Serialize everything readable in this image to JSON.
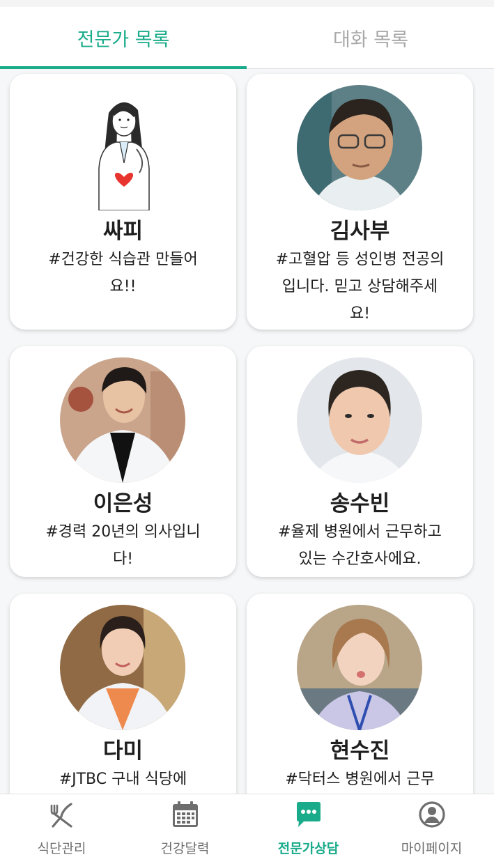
{
  "tabs": [
    {
      "label": "전문가 목록",
      "active": true
    },
    {
      "label": "대화 목록",
      "active": false
    }
  ],
  "colors": {
    "accent": "#1aab8a",
    "inactive_tab": "#a8a8a8",
    "nav_icon": "#6e6e6e"
  },
  "experts": [
    {
      "name": "싸피",
      "description": "#건강한 식습관 만들어요!!",
      "avatar": "illustrated-doctor-holding-heart"
    },
    {
      "name": "김사부",
      "description": "#고혈압 등 성인병 전공의입니다. 믿고 상담해주세요!",
      "avatar": "photo-male-doctor-glasses"
    },
    {
      "name": "이은성",
      "description": "#경력 20년의 의사입니다!",
      "avatar": "photo-male-doctor-white-coat"
    },
    {
      "name": "송수빈",
      "description": "#율제 병원에서 근무하고 있는 수간호사에요.",
      "avatar": "photo-female-nurse"
    },
    {
      "name": "다미",
      "description": "#JTBC 구내 식당에",
      "avatar": "photo-female-doctor-orange-top"
    },
    {
      "name": "현수진",
      "description": "#닥터스 병원에서 근무",
      "avatar": "photo-female-staff-lanyard"
    }
  ],
  "nav": [
    {
      "label": "식단관리",
      "icon": "fork-knife-icon",
      "active": false
    },
    {
      "label": "건강달력",
      "icon": "calendar-icon",
      "active": false
    },
    {
      "label": "전문가상담",
      "icon": "chat-bubble-icon",
      "active": true
    },
    {
      "label": "마이페이지",
      "icon": "user-icon",
      "active": false
    }
  ]
}
